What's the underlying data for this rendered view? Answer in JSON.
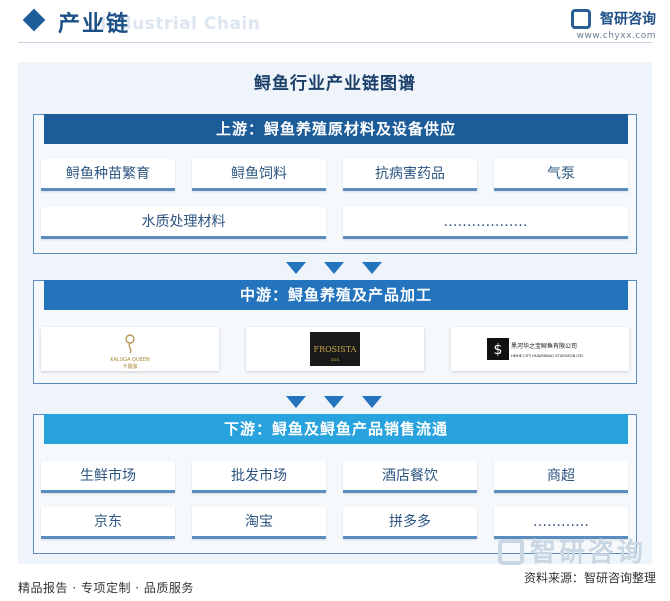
{
  "header": {
    "title": "产业链",
    "title_en": "Industrial Chain",
    "brand_name": "智研咨询",
    "brand_url": "www.chyxx.com"
  },
  "main_title": "鲟鱼行业产业链图谱",
  "upstream": {
    "title": "上游：鲟鱼养殖原材料及设备供应",
    "items": [
      "鲟鱼种苗繁育",
      "鲟鱼饲料",
      "抗病害药品",
      "气泵",
      "水质处理材料",
      "………………"
    ]
  },
  "midstream": {
    "title": "中游：鲟鱼养殖及产品加工",
    "logos": [
      {
        "text": "KALUGA QUEEN",
        "sub": "卡露伽",
        "color": "#b08a3e"
      },
      {
        "text": "FROSISTA",
        "sub": "XXX",
        "color": "#c9a44a"
      },
      {
        "text": "黑河华之宝鲟鱼有限公司",
        "sub": "HEIHE CITY HUAZHIBAO STURGEON LTD",
        "color": "#111111"
      }
    ]
  },
  "downstream": {
    "title": "下游：鲟鱼及鲟鱼产品销售流通",
    "items": [
      "生鲜市场",
      "批发市场",
      "酒店餐饮",
      "商超",
      "京东",
      "淘宝",
      "拼多多",
      "…………"
    ]
  },
  "footer": {
    "left": "精品报告 · 专项定制 · 品质服务",
    "source": "资料来源：智研咨询整理",
    "watermark": "智研咨询"
  },
  "colors": {
    "upstream": "#1c5c98",
    "midstream": "#2373bd",
    "downstream": "#29a3de"
  }
}
